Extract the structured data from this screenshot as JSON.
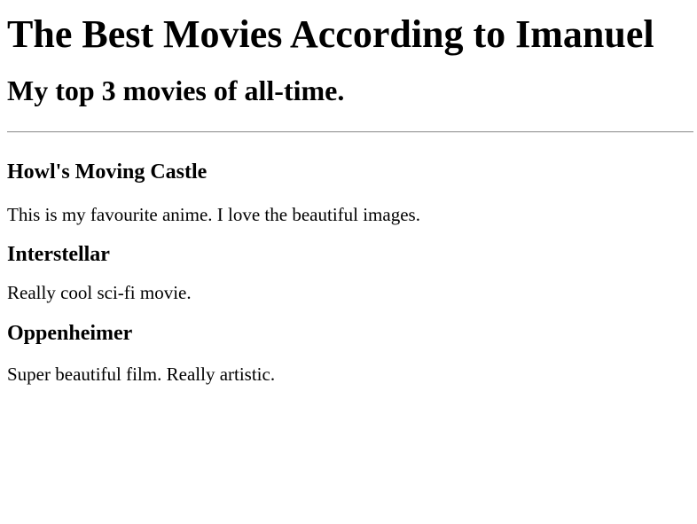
{
  "page": {
    "title": "The Best Movies According to Imanuel",
    "subtitle": "My top 3 movies of all-time."
  },
  "movies": [
    {
      "title": "Howl's Moving Castle",
      "description": "This is my favourite anime. I love the beautiful images."
    },
    {
      "title": "Interstellar",
      "description": "Really cool sci-fi movie."
    },
    {
      "title": "Oppenheimer",
      "description": "Super beautiful film. Really artistic."
    }
  ]
}
